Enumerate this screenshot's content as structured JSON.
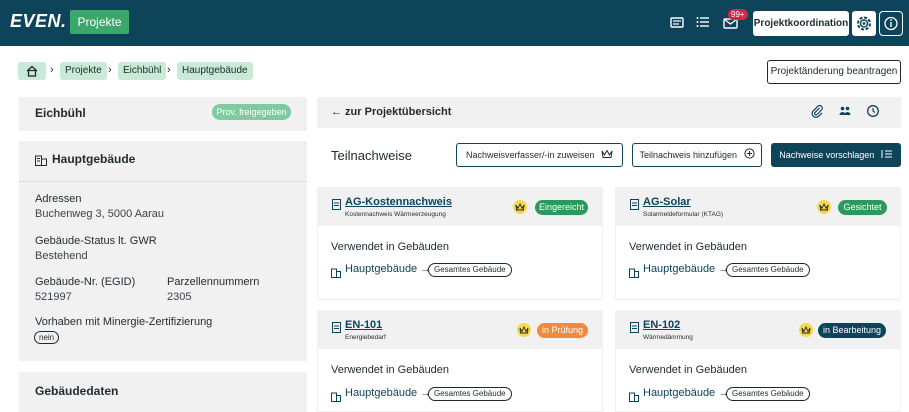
{
  "topbar": {
    "logo": "EVEN.",
    "projects_button": "Projekte",
    "mail_badge": "99+",
    "role_button": "Projektkoordination"
  },
  "breadcrumb": {
    "items": [
      "Projekte",
      "Eichbühl",
      "Hauptgebäude"
    ]
  },
  "change_request_button": "Projektänderung beantragen",
  "sidebar": {
    "project_title": "Eichbühl",
    "project_status": "Prov. freigegeben",
    "building_title": "Hauptgebäude",
    "address_label": "Adressen",
    "address_value": "Buchenweg 3, 5000 Aarau",
    "gwr_label": "Gebäude-Status lt. GWR",
    "gwr_value": "Bestehend",
    "egid_label": "Gebäude-Nr. (EGID)",
    "egid_value": "521997",
    "parcel_label": "Parzellennummern",
    "parcel_value": "2305",
    "minergie_label": "Vorhaben mit Minergie-Zertifizierung",
    "minergie_value": "nein",
    "building_data_title": "Gebäudedaten"
  },
  "main": {
    "back_link": "← zur Projektübersicht",
    "section_title": "Teilnachweise",
    "assign_button": "Nachweisverfasser/-in zuweisen",
    "add_button": "Teilnachweis hinzufügen",
    "suggest_button": "Nachweise vorschlagen"
  },
  "cards": [
    {
      "name": "AG-Kostennachweis",
      "subtitle": "Kostennachweis Wärmeerzeugung",
      "status": "Eingereicht",
      "status_color": "#2a9a5c",
      "used_label": "Verwendet in Gebäuden",
      "building": "Hauptgebäude →",
      "scope": "Gesamtes Gebäude"
    },
    {
      "name": "AG-Solar",
      "subtitle": "Solarmeldeformular (KTAG)",
      "status": "Gesichtet",
      "status_color": "#2a9a5c",
      "used_label": "Verwendet in Gebäuden",
      "building": "Hauptgebäude →",
      "scope": "Gesamtes Gebäude"
    },
    {
      "name": "EN-101",
      "subtitle": "Energiebedarf",
      "status": "in Prüfung",
      "status_color": "#f08a3c",
      "used_label": "Verwendet in Gebäuden",
      "building": "Hauptgebäude →",
      "scope": "Gesamtes Gebäude"
    },
    {
      "name": "EN-102",
      "subtitle": "Wärmedämmung",
      "status": "in Bearbeitung",
      "status_color": "#0d4459",
      "used_label": "Verwendet in Gebäuden",
      "building": "Hauptgebäude →",
      "scope": "Gesamtes Gebäude"
    }
  ],
  "icons": {
    "home": "home-icon",
    "mail": "mail-icon",
    "tasks": "tasks-icon",
    "notifications": "envelope-icon",
    "settings": "gear-icon",
    "info": "info-icon",
    "attachment": "paperclip-icon",
    "users": "users-icon",
    "history": "clock-icon",
    "building": "building-icon",
    "document": "document-icon",
    "crown": "crown-icon"
  },
  "colors": {
    "brand": "#0d4459",
    "accent_green": "#3aa86b",
    "breadcrumb_bg": "#c9ead6",
    "panel_bg": "#f1f1f1"
  }
}
